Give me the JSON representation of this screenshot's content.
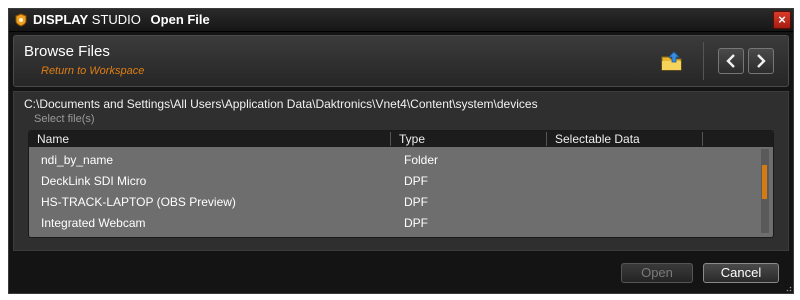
{
  "window": {
    "brand": "DISPLAY",
    "brand_sub": "STUDIO",
    "dialog_title": "Open File",
    "close_label": "×"
  },
  "header": {
    "title": "Browse Files",
    "return_link": "Return to Workspace"
  },
  "path": "C:\\Documents and Settings\\All Users\\Application Data\\Daktronics\\Vnet4\\Content\\system\\devices",
  "select_label": "Select file(s)",
  "columns": {
    "name": "Name",
    "type": "Type",
    "selectable": "Selectable Data"
  },
  "rows": [
    {
      "name": "ndi_by_name",
      "type": "Folder"
    },
    {
      "name": "DeckLink SDI Micro",
      "type": "DPF"
    },
    {
      "name": "HS-TRACK-LAPTOP (OBS Preview)",
      "type": "DPF"
    },
    {
      "name": "Integrated Webcam",
      "type": "DPF"
    }
  ],
  "buttons": {
    "open": "Open",
    "cancel": "Cancel"
  },
  "colors": {
    "accent": "#e07e12",
    "close_red": "#c0281a"
  },
  "icons": {
    "app": "display-studio-logo-icon",
    "folder_up": "folder-up-icon",
    "back": "chevron-left-icon",
    "forward": "chevron-right-icon"
  }
}
